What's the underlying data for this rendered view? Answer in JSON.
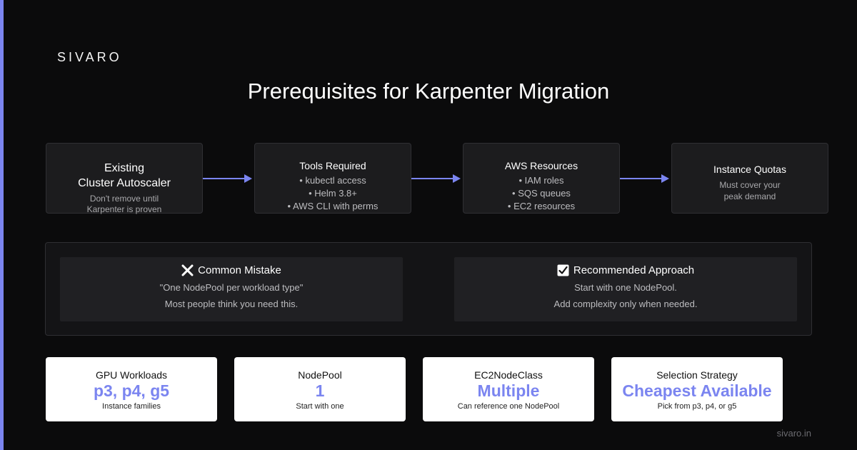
{
  "brand": "SIVARO",
  "title": "Prerequisites for Karpenter Migration",
  "steps": [
    {
      "title_line1": "Existing",
      "title_line2": "Cluster Autoscaler",
      "sub_line1": "Don't remove until",
      "sub_line2": "Karpenter is proven"
    },
    {
      "title": "Tools Required",
      "items": [
        "kubectl access",
        "Helm 3.8+",
        "AWS CLI with perms"
      ]
    },
    {
      "title": "AWS Resources",
      "items": [
        "IAM roles",
        "SQS queues",
        "EC2 resources"
      ]
    },
    {
      "title": "Instance Quotas",
      "sub_line1": "Must cover your",
      "sub_line2": "peak demand"
    }
  ],
  "comparison": {
    "mistake": {
      "title": "Common Mistake",
      "line1": "\"One NodePool per workload type\"",
      "line2": "Most people think you need this."
    },
    "recommended": {
      "title": "Recommended Approach",
      "line1": "Start with one NodePool.",
      "line2": "Add complexity only when needed."
    }
  },
  "metrics": [
    {
      "label": "GPU Workloads",
      "value": "p3, p4, g5",
      "sub": "Instance families"
    },
    {
      "label": "NodePool",
      "value": "1",
      "sub": "Start with one"
    },
    {
      "label": "EC2NodeClass",
      "value": "Multiple",
      "sub": "Can reference one NodePool"
    },
    {
      "label": "Selection Strategy",
      "value": "Cheapest Available",
      "sub": "Pick from p3, p4, or g5"
    }
  ],
  "footer": "sivaro.in",
  "colors": {
    "accent": "#7b85f0",
    "background": "#0b0b0c",
    "card": "#1c1c1e"
  }
}
